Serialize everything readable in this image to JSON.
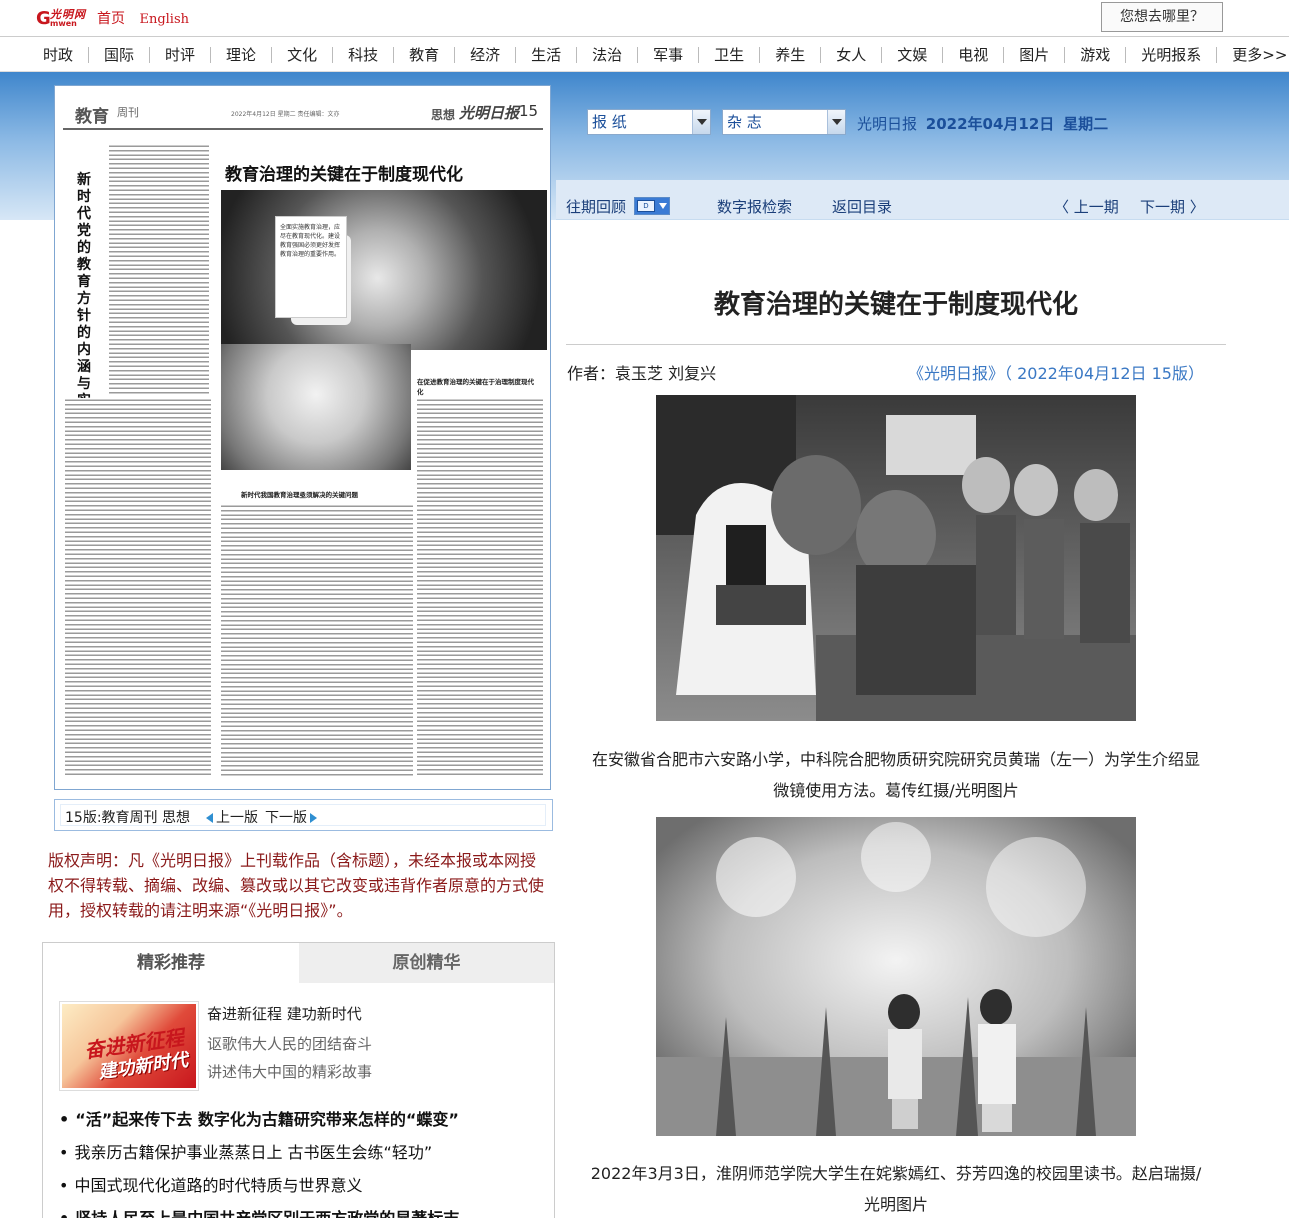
{
  "top": {
    "home": "首页",
    "english": "English",
    "where_button": "您想去哪里？"
  },
  "nav": [
    "时政",
    "国际",
    "时评",
    "理论",
    "文化",
    "科技",
    "教育",
    "经济",
    "生活",
    "法治",
    "军事",
    "卫生",
    "养生",
    "女人",
    "文娱",
    "电视",
    "图片",
    "游戏",
    "光明报系",
    "更多>>"
  ],
  "header": {
    "select_paper": "报 纸",
    "select_magazine": "杂 志",
    "paper_name": "光明日报",
    "date": "2022年04月12日",
    "weekday": "星期二",
    "past_issues": "往期回顾",
    "calendar_label": "D",
    "digital_search": "数字报检索",
    "back_to_index": "返回目录",
    "prev_issue": "上一期",
    "next_issue": "下一期"
  },
  "thumbnail": {
    "section": "教育",
    "weekly": "周刊",
    "meta": "2022年4月12日  星期二  责任编辑：文亦",
    "page_name": "思想",
    "logo": "光明日报",
    "page_no": "15",
    "left_headline": "新时代党的教育方针的内涵与实施",
    "main_headline": "教育治理的关键在于制度现代化",
    "sub_headline_1": "在促进教育治理的关键在于治理制度现代化",
    "sub_headline_2": "新时代我国教育治理亟须解决的关键问题",
    "quote": "全面实施教育治理，应尽在教育现代化。建设教育强国必须更好发挥教育治理的重要作用。"
  },
  "pagenav": {
    "label": "15版:教育周刊 思想",
    "prev": "上一版",
    "next": "下一版"
  },
  "copyright": "版权声明：凡《光明日报》上刊载作品（含标题），未经本报或本网授权不得转载、摘编、改编、篡改或以其它改变或违背作者原意的方式使用，授权转载的请注明来源“《光明日报》”。",
  "recommend": {
    "tab1": "精彩推荐",
    "tab2": "原创精华",
    "feature_pic_text_1": "奋进新征程",
    "feature_pic_text_2": "建功新时代",
    "feature_title": "奋进新征程  建功新时代",
    "feature_sub1": "讴歌伟大人民的团结奋斗",
    "feature_sub2": "讲述伟大中国的精彩故事",
    "items": [
      "“活”起来传下去 数字化为古籍研究带来怎样的“蝶变”",
      "我亲历古籍保护事业蒸蒸日上   古书医生会练“轻功”",
      "中国式现代化道路的时代特质与世界意义",
      "坚持人民至上是中国共产党区别于西方政党的显著标志"
    ]
  },
  "article": {
    "title": "教育治理的关键在于制度现代化",
    "author": "作者：袁玉芝  刘复兴",
    "source": "《光明日报》（ 2022年04月12日   15版）",
    "caption1": "在安徽省合肥市六安路小学，中科院合肥物质研究院研究员黄瑞（左一）为学生介绍显微镜使用方法。葛传红摄/光明图片",
    "caption2": "2022年3月3日，淮阴师范学院大学生在姹紫嫣红、芬芳四逸的校园里读书。赵启瑞摄/光明图片"
  },
  "colors": {
    "brand_red": "#c8161d",
    "link_blue": "#1b4f9a",
    "copyright_red": "#8b1a1a",
    "banner_blue": "#3f86cc"
  }
}
